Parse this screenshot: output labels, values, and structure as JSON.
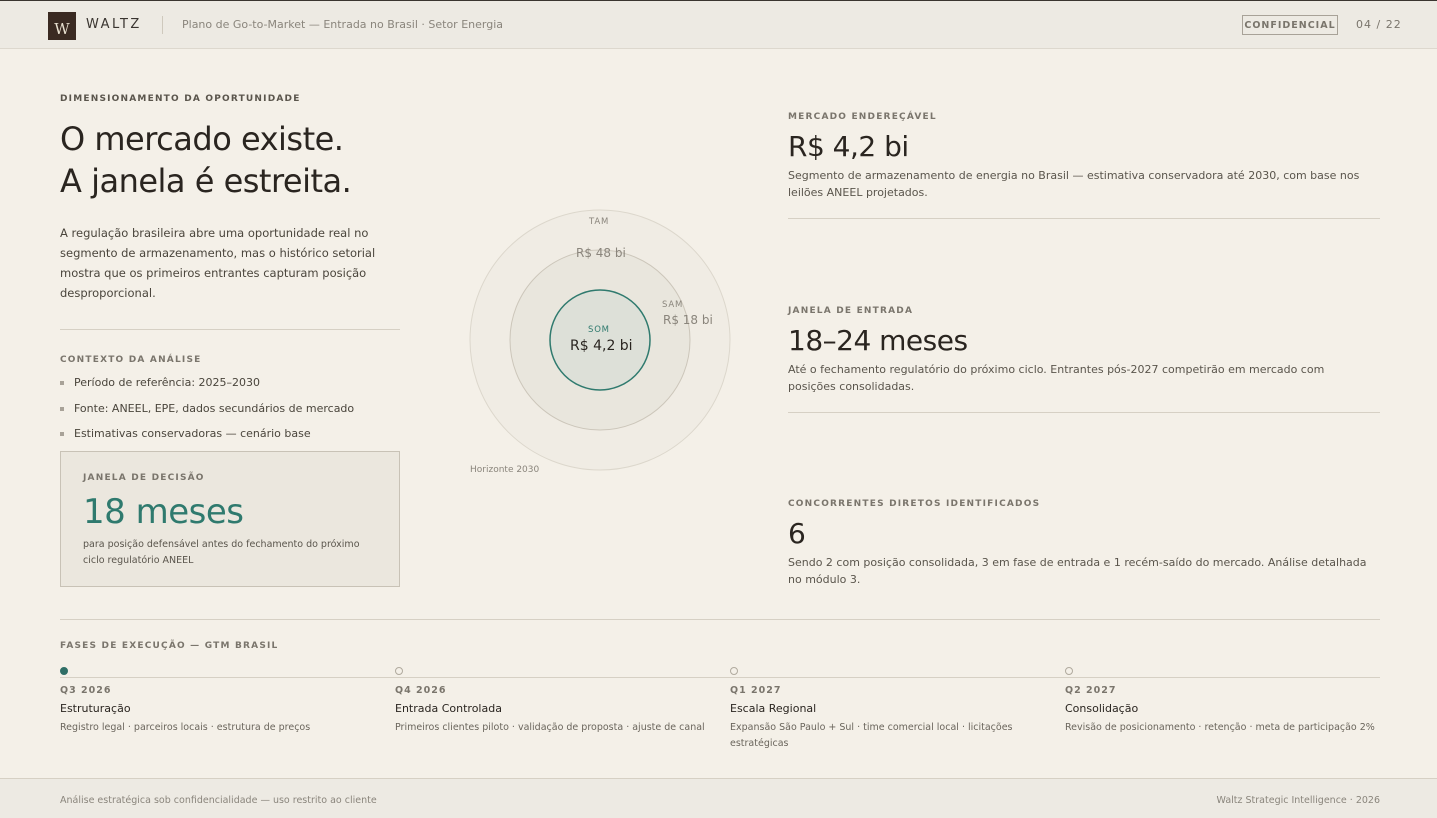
{
  "header": {
    "logo_letter": "W",
    "brand": "WALTZ",
    "title": "Plano de Go-to-Market — Entrada no Brasil · Setor Energia",
    "confidential": "CONFIDENCIAL",
    "page": "04 / 22"
  },
  "left": {
    "eyebrow": "DIMENSIONAMENTO DA OPORTUNIDADE",
    "headline_1": "O mercado existe.",
    "headline_2": "A janela é estreita.",
    "intro": "A regulação brasileira abre uma oportunidade real no segmento de armazenamento, mas o histórico setorial mostra que os primeiros entrantes capturam posição desproporcional.",
    "context_title": "CONTEXTO DA ANÁLISE",
    "context_items": [
      "Período de referência: 2025–2030",
      "Fonte: ANEEL, EPE, dados secundários de mercado",
      "Estimativas conservadoras — cenário base"
    ],
    "decision": {
      "label": "JANELA DE DECISÃO",
      "value": "18 meses",
      "sub": "para posição defensável antes do fechamento do próximo ciclo regulatório ANEEL"
    }
  },
  "market_circles": {
    "tam_label": "TAM",
    "tam_value": "R$ 48 bi",
    "sam_label": "SAM",
    "sam_value": "R$ 18 bi",
    "som_label": "SOM",
    "som_value": "R$ 4,2 bi",
    "horizon": "Horizonte 2030",
    "colors": {
      "som_stroke": "#2f7a6e",
      "som_fill": "#dde0d8",
      "sam_fill": "#e9e6dd",
      "tam_fill": "#f0ece4"
    }
  },
  "metrics": [
    {
      "label": "MERCADO ENDEREÇÁVEL",
      "value": "R$ 4,2 bi",
      "desc": "Segmento de armazenamento de energia no Brasil — estimativa conservadora até 2030, com base nos leilões ANEEL projetados."
    },
    {
      "label": "JANELA DE ENTRADA",
      "value": "18–24 meses",
      "desc": "Até o fechamento regulatório do próximo ciclo. Entrantes pós-2027 competirão em mercado com posições consolidadas."
    },
    {
      "label": "CONCORRENTES DIRETOS IDENTIFICADOS",
      "value": "6",
      "desc": "Sendo 2 com posição consolidada, 3 em fase de entrada e 1 recém-saído do mercado. Análise detalhada no módulo 3."
    }
  ],
  "phases": {
    "title": "FASES DE EXECUÇÃO — GTM BRASIL",
    "items": [
      {
        "quarter": "Q3 2026",
        "title": "Estruturação",
        "desc": "Registro legal · parceiros locais · estrutura de preços",
        "active": true
      },
      {
        "quarter": "Q4 2026",
        "title": "Entrada Controlada",
        "desc": "Primeiros clientes piloto · validação de proposta · ajuste de canal",
        "active": false
      },
      {
        "quarter": "Q1 2027",
        "title": "Escala Regional",
        "desc": "Expansão São Paulo + Sul · time comercial local · licitações estratégicas",
        "active": false
      },
      {
        "quarter": "Q2 2027",
        "title": "Consolidação",
        "desc": "Revisão de posicionamento · retenção · meta de participação 2%",
        "active": false
      }
    ]
  },
  "footer": {
    "left": "Análise estratégica sob confidencialidade — uso restrito ao cliente",
    "right": "Waltz Strategic Intelligence · 2026"
  }
}
